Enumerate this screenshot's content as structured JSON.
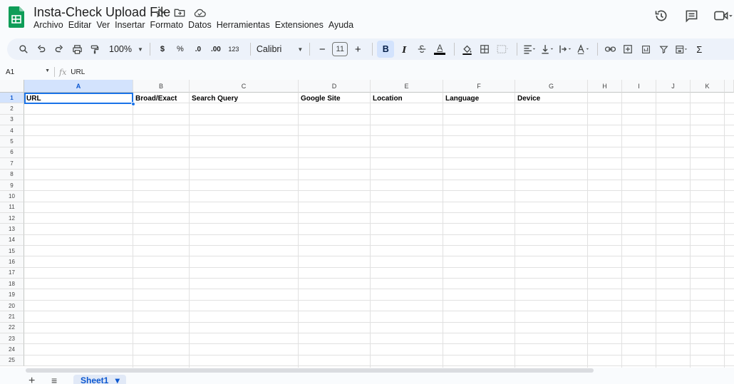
{
  "app": {
    "title": "Insta-Check Upload File",
    "menu": [
      "Archivo",
      "Editar",
      "Ver",
      "Insertar",
      "Formato",
      "Datos",
      "Herramientas",
      "Extensiones",
      "Ayuda"
    ]
  },
  "toolbar": {
    "zoom": "100%",
    "currency": "$",
    "percent": "%",
    "decrease_decimals": ".0",
    "increase_decimals": ".00",
    "number_format": "123",
    "font": "Calibri",
    "font_size": "11",
    "minus": "−",
    "plus": "+",
    "bold": "B",
    "italic": "I",
    "text_color_letter": "A",
    "sigma": "Σ"
  },
  "formula_bar": {
    "cell_ref": "A1",
    "fx": "fx",
    "value": "URL"
  },
  "grid": {
    "columns": [
      "A",
      "B",
      "C",
      "D",
      "E",
      "F",
      "G",
      "H",
      "I",
      "J",
      "K"
    ],
    "rows": [
      "1",
      "2",
      "3",
      "4",
      "5",
      "6",
      "7",
      "8",
      "9",
      "10",
      "11",
      "12",
      "13",
      "14",
      "15",
      "16",
      "17",
      "18",
      "19",
      "20",
      "21",
      "22",
      "23",
      "24",
      "25"
    ],
    "selected_cell": "A1",
    "row1": [
      "URL",
      "Broad/Exact",
      "Search Query",
      "Google Site",
      "Location",
      "Language",
      "Device"
    ]
  },
  "sheets": {
    "add": "+",
    "list": "≡",
    "active": "Sheet1",
    "active_caret": "▾"
  },
  "colors": {
    "accent": "#1a73e8",
    "selected_header": "#d3e3fd",
    "logo_green": "#0f9d58"
  }
}
